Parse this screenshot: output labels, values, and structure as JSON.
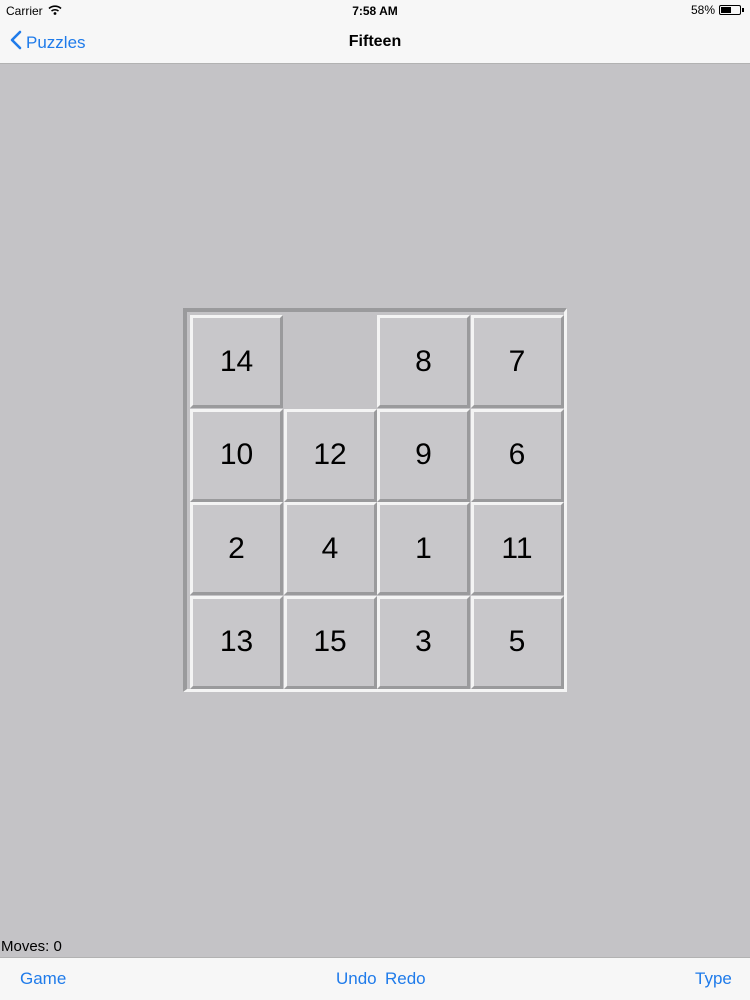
{
  "status_bar": {
    "carrier": "Carrier",
    "time": "7:58 AM",
    "battery": "58%",
    "battery_level": 0.58
  },
  "nav": {
    "back_label": "Puzzles",
    "title": "Fifteen"
  },
  "board": {
    "tiles": [
      "14",
      "",
      "8",
      "7",
      "10",
      "12",
      "9",
      "6",
      "2",
      "4",
      "1",
      "11",
      "13",
      "15",
      "3",
      "5"
    ]
  },
  "moves_label": "Moves: 0",
  "toolbar": {
    "game": "Game",
    "undo": "Undo",
    "redo": "Redo",
    "type": "Type"
  },
  "colors": {
    "accent": "#1f7bea",
    "background": "#c4c3c6",
    "bar": "#f7f7f7"
  },
  "icons": [
    "wifi-icon",
    "battery-icon",
    "chevron-left-icon"
  ]
}
